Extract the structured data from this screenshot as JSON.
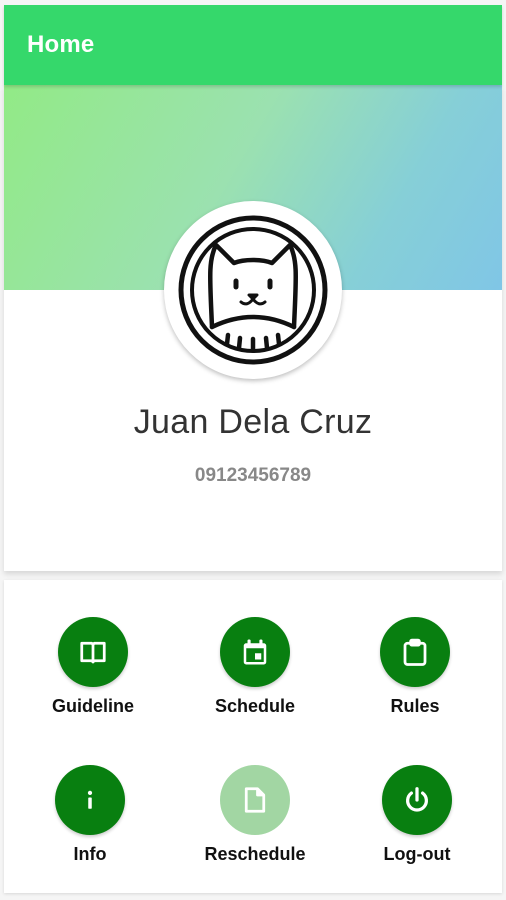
{
  "appbar": {
    "title": "Home",
    "color": "#35d86b"
  },
  "profile": {
    "name": "Juan Dela Cruz",
    "phone": "09123456789",
    "avatar_icon": "cat-avatar-icon"
  },
  "menu": {
    "accent_color": "#087f10",
    "disabled_color": "#a2d6a3",
    "items": [
      {
        "label": "Guideline",
        "icon": "book-icon",
        "enabled": true
      },
      {
        "label": "Schedule",
        "icon": "calendar-icon",
        "enabled": true
      },
      {
        "label": "Rules",
        "icon": "clipboard-icon",
        "enabled": true
      },
      {
        "label": "Info",
        "icon": "info-icon",
        "enabled": true
      },
      {
        "label": "Reschedule",
        "icon": "document-icon",
        "enabled": false
      },
      {
        "label": "Log-out",
        "icon": "power-icon",
        "enabled": true
      }
    ]
  }
}
